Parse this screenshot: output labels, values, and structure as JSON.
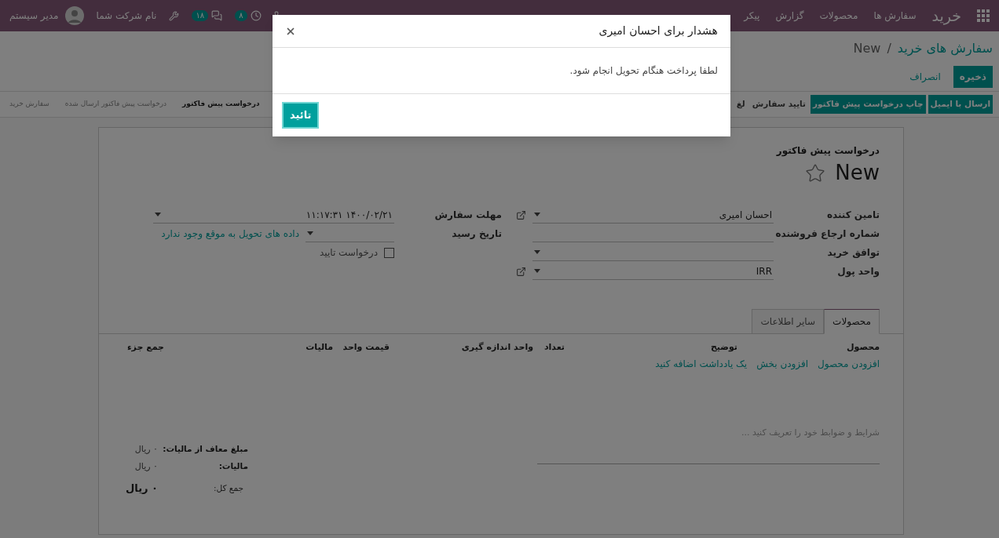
{
  "navbar": {
    "app_name": "خرید",
    "menus": [
      "سفارش ها",
      "محصولات",
      "گزارش",
      "پیکر"
    ],
    "activity_count": "۸",
    "message_count": "۱۸",
    "company": "نام شرکت شما",
    "user": "مدیر سیستم"
  },
  "breadcrumb": {
    "parent": "سفارش های خرید",
    "separator": "/",
    "current": "New"
  },
  "actions": {
    "save": "ذخیره",
    "discard": "انصراف"
  },
  "header_buttons": [
    {
      "label": "ارسال با ایمیل",
      "primary": true
    },
    {
      "label": "چاپ درخواست پیش فاکتور",
      "primary": true
    },
    {
      "label": "تایید سفارش",
      "primary": false
    },
    {
      "label": "لغ",
      "primary": false
    }
  ],
  "status_stages": [
    {
      "label": "درخواست پیش فاکتور",
      "selected": true
    },
    {
      "label": "درخواست پیش فاکتور ارسال شده",
      "selected": false
    },
    {
      "label": "سفارش خرید",
      "selected": false
    }
  ],
  "form": {
    "subtitle": "درخواست پیش فاکتور",
    "title": "New",
    "starred": false,
    "fields_right": [
      {
        "label": "تامین کننده",
        "value": "احسان امیری",
        "kind": "many2one",
        "link": true
      },
      {
        "label": "شماره ارجاع فروشنده",
        "kind": "char"
      },
      {
        "label": "توافق خرید",
        "kind": "many2one",
        "link": false
      },
      {
        "label": "واحد پول",
        "value": "IRR",
        "kind": "many2one",
        "link": true
      }
    ],
    "fields_left": [
      {
        "label": "مهلت سفارش",
        "value": "۱۴۰۰/۰۲/۲۱ ۱۱:۱۷:۳۱",
        "kind": "datetime"
      },
      {
        "label": "تاریخ رسید",
        "kind": "datetime",
        "note": "داده های تحویل به موقع وجود ندارد"
      },
      {
        "label": "درخواست تایید",
        "kind": "checkbox",
        "checked": false
      }
    ]
  },
  "tabs": [
    {
      "label": "محصولات",
      "selected": true
    },
    {
      "label": "سایر اطلاعات",
      "selected": false
    }
  ],
  "table": {
    "columns": [
      "محصول",
      "توضیح",
      "تعداد",
      "واحد اندازه گیری",
      "قیمت واحد",
      "مالیات",
      "جمع جزء"
    ],
    "add_links": [
      "افزودن محصول",
      "افزودن بخش",
      "یک یادداشت اضافه کنید"
    ]
  },
  "notes": {
    "placeholder": "شرایط و ضوابط خود را تعریف کنید ..."
  },
  "totals": [
    {
      "label": "مبلغ معاف از مالیات:",
      "value": "۰ ریال",
      "kind": "line"
    },
    {
      "label": "مالیات:",
      "value": "۰ ریال",
      "kind": "line"
    },
    {
      "label": "جمع کل:",
      "value": "۰ ریال",
      "kind": "grand"
    }
  ],
  "dialog": {
    "title": "هشدار برای احسان امیری",
    "message": "لطفا پرداخت هنگام تحویل انجام شود.",
    "button": "تائید"
  }
}
